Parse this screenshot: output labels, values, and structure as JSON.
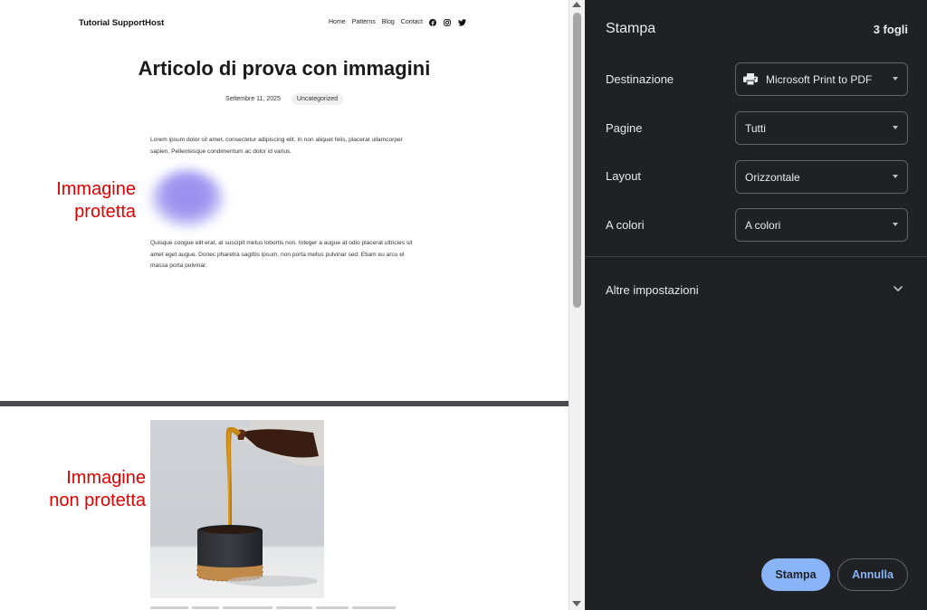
{
  "preview": {
    "site_title": "Tutorial SupportHost",
    "nav": [
      "Home",
      "Patterns",
      "Blog",
      "Contact"
    ],
    "social_icons": [
      "facebook-icon",
      "instagram-icon",
      "twitter-icon"
    ],
    "article_title": "Articolo di prova con immagini",
    "date": "Settembre 11, 2025",
    "category": "Uncategorized",
    "paragraph1": "Lorem ipsum dolor sit amet, consectetur adipiscing elit. In non aliquet felis, placerat ullamcorper sapien. Pellentesque condimentum ac dolor id varius.",
    "paragraph2": "Quisque congue elit erat, at suscipit metus lobortis non. Integer a augue at odio placerat ultricies sit amet eget augue. Donec pharetra sagittis ipsum, non porta metus pulvinar sed. Etiam eu arcu et massa porta pulvinar.",
    "annotation_protected": [
      "Immagine",
      "protetta"
    ],
    "annotation_unprotected": [
      "Immagine",
      "non protetta"
    ]
  },
  "dialog": {
    "title": "Stampa",
    "sheets": "3 fogli",
    "rows": [
      {
        "label": "Destinazione",
        "value": "Microsoft Print to PDF",
        "icon": "printer-icon"
      },
      {
        "label": "Pagine",
        "value": "Tutti"
      },
      {
        "label": "Layout",
        "value": "Orizzontale"
      },
      {
        "label": "A colori",
        "value": "A colori"
      }
    ],
    "more_settings": "Altre impostazioni",
    "print_button": "Stampa",
    "cancel_button": "Annulla",
    "colors": {
      "background": "#202124",
      "accent": "#8ab4f8",
      "border": "#5f6368"
    }
  }
}
